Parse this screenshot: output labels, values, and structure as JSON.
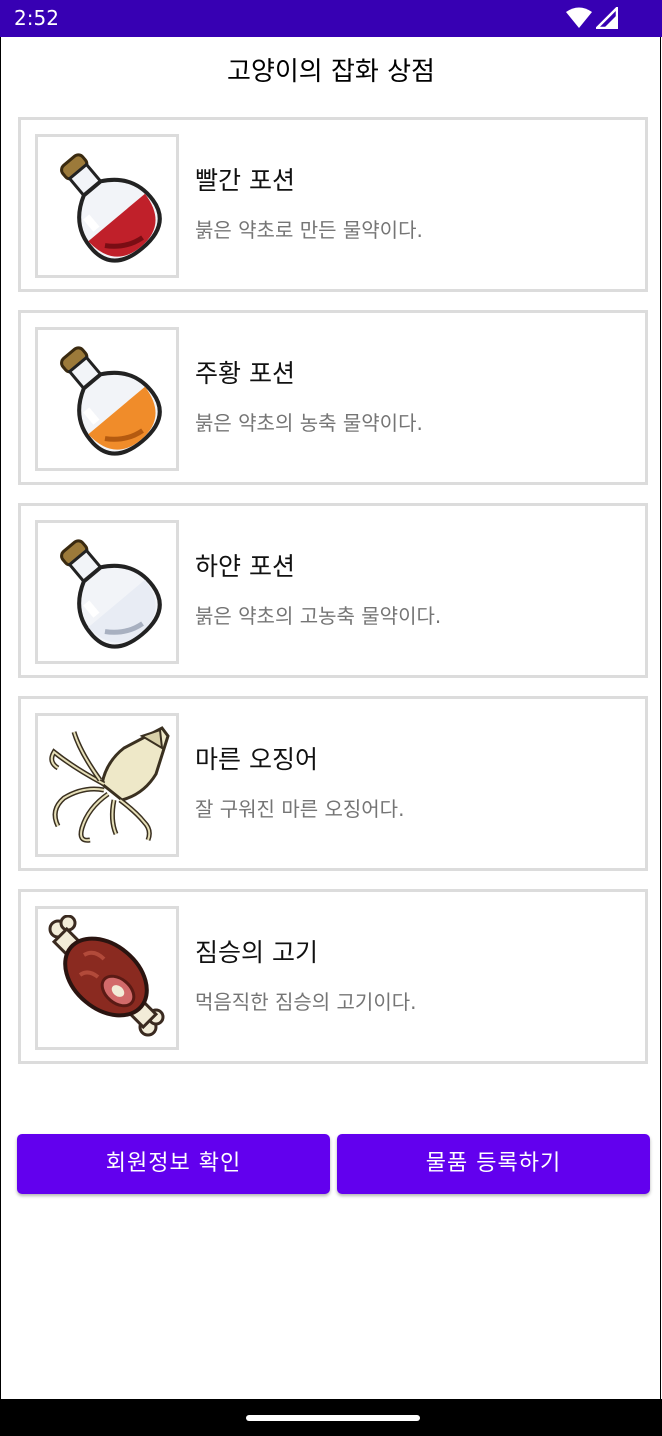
{
  "status_bar": {
    "time": "2:52",
    "icons": [
      "wifi-icon",
      "signal-icon"
    ],
    "background": "#3700b3"
  },
  "app": {
    "title": "고양이의 잡화 상점"
  },
  "items": [
    {
      "name": "빨간 포션",
      "description": "붉은 약초로 만든 물약이다.",
      "icon": "red-potion-icon",
      "liquid_color": "#c0202a"
    },
    {
      "name": "주황 포션",
      "description": "붉은 약초의 농축 물약이다.",
      "icon": "orange-potion-icon",
      "liquid_color": "#f08c2a"
    },
    {
      "name": "하얀 포션",
      "description": "붉은 약초의 고농축 물약이다.",
      "icon": "white-potion-icon",
      "liquid_color": "#e8ecf4"
    },
    {
      "name": "마른 오징어",
      "description": "잘 구워진 마른 오징어다.",
      "icon": "dried-squid-icon"
    },
    {
      "name": "짐승의 고기",
      "description": "먹음직한 짐승의 고기이다.",
      "icon": "meat-icon"
    }
  ],
  "buttons": {
    "member_info": "회원정보 확인",
    "register_item": "물품 등록하기",
    "color": "#6200ee"
  }
}
